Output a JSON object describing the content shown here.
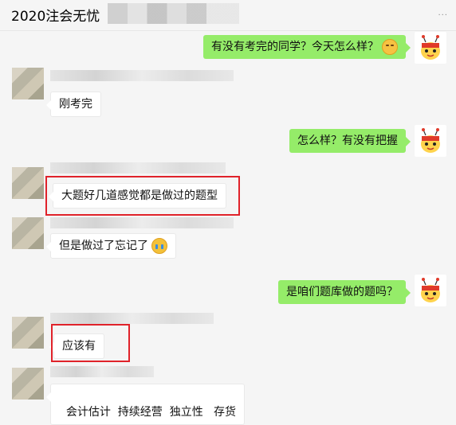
{
  "header": {
    "title": "2020注会无忧",
    "more": "···"
  },
  "messages": [
    {
      "side": "right",
      "text": "有没有考完的同学？今天怎么样？",
      "emoji": "smile"
    },
    {
      "side": "left",
      "text": "刚考完"
    },
    {
      "side": "right",
      "text": "怎么样？有没有把握"
    },
    {
      "side": "left",
      "text": "大题好几道感觉都是做过的题型"
    },
    {
      "side": "left",
      "text": "但是做过了忘记了",
      "emoji": "cry"
    },
    {
      "side": "right",
      "text": "是咱们题库做的题吗？"
    },
    {
      "side": "left",
      "text": "应该有"
    },
    {
      "side": "left",
      "text": "会计估计  持续经营  独立性   存货"
    }
  ],
  "colors": {
    "sent_bubble": "#95ec69",
    "received_bubble": "#ffffff",
    "highlight": "#e0222a"
  }
}
